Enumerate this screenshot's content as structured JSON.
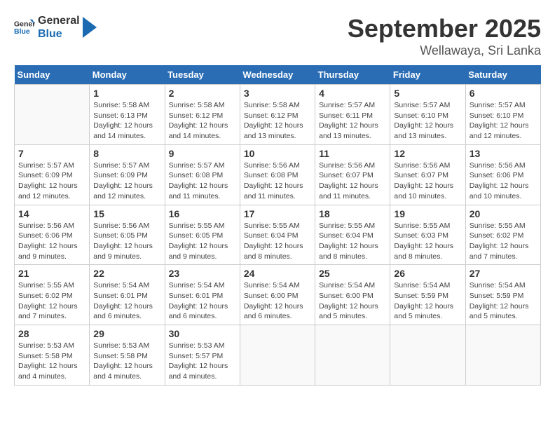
{
  "header": {
    "logo_general": "General",
    "logo_blue": "Blue",
    "title": "September 2025",
    "subtitle": "Wellawaya, Sri Lanka"
  },
  "calendar": {
    "days_of_week": [
      "Sunday",
      "Monday",
      "Tuesday",
      "Wednesday",
      "Thursday",
      "Friday",
      "Saturday"
    ],
    "weeks": [
      [
        {
          "day": "",
          "info": ""
        },
        {
          "day": "1",
          "info": "Sunrise: 5:58 AM\nSunset: 6:13 PM\nDaylight: 12 hours\nand 14 minutes."
        },
        {
          "day": "2",
          "info": "Sunrise: 5:58 AM\nSunset: 6:12 PM\nDaylight: 12 hours\nand 14 minutes."
        },
        {
          "day": "3",
          "info": "Sunrise: 5:58 AM\nSunset: 6:12 PM\nDaylight: 12 hours\nand 13 minutes."
        },
        {
          "day": "4",
          "info": "Sunrise: 5:57 AM\nSunset: 6:11 PM\nDaylight: 12 hours\nand 13 minutes."
        },
        {
          "day": "5",
          "info": "Sunrise: 5:57 AM\nSunset: 6:10 PM\nDaylight: 12 hours\nand 13 minutes."
        },
        {
          "day": "6",
          "info": "Sunrise: 5:57 AM\nSunset: 6:10 PM\nDaylight: 12 hours\nand 12 minutes."
        }
      ],
      [
        {
          "day": "7",
          "info": "Sunrise: 5:57 AM\nSunset: 6:09 PM\nDaylight: 12 hours\nand 12 minutes."
        },
        {
          "day": "8",
          "info": "Sunrise: 5:57 AM\nSunset: 6:09 PM\nDaylight: 12 hours\nand 12 minutes."
        },
        {
          "day": "9",
          "info": "Sunrise: 5:57 AM\nSunset: 6:08 PM\nDaylight: 12 hours\nand 11 minutes."
        },
        {
          "day": "10",
          "info": "Sunrise: 5:56 AM\nSunset: 6:08 PM\nDaylight: 12 hours\nand 11 minutes."
        },
        {
          "day": "11",
          "info": "Sunrise: 5:56 AM\nSunset: 6:07 PM\nDaylight: 12 hours\nand 11 minutes."
        },
        {
          "day": "12",
          "info": "Sunrise: 5:56 AM\nSunset: 6:07 PM\nDaylight: 12 hours\nand 10 minutes."
        },
        {
          "day": "13",
          "info": "Sunrise: 5:56 AM\nSunset: 6:06 PM\nDaylight: 12 hours\nand 10 minutes."
        }
      ],
      [
        {
          "day": "14",
          "info": "Sunrise: 5:56 AM\nSunset: 6:06 PM\nDaylight: 12 hours\nand 9 minutes."
        },
        {
          "day": "15",
          "info": "Sunrise: 5:56 AM\nSunset: 6:05 PM\nDaylight: 12 hours\nand 9 minutes."
        },
        {
          "day": "16",
          "info": "Sunrise: 5:55 AM\nSunset: 6:05 PM\nDaylight: 12 hours\nand 9 minutes."
        },
        {
          "day": "17",
          "info": "Sunrise: 5:55 AM\nSunset: 6:04 PM\nDaylight: 12 hours\nand 8 minutes."
        },
        {
          "day": "18",
          "info": "Sunrise: 5:55 AM\nSunset: 6:04 PM\nDaylight: 12 hours\nand 8 minutes."
        },
        {
          "day": "19",
          "info": "Sunrise: 5:55 AM\nSunset: 6:03 PM\nDaylight: 12 hours\nand 8 minutes."
        },
        {
          "day": "20",
          "info": "Sunrise: 5:55 AM\nSunset: 6:02 PM\nDaylight: 12 hours\nand 7 minutes."
        }
      ],
      [
        {
          "day": "21",
          "info": "Sunrise: 5:55 AM\nSunset: 6:02 PM\nDaylight: 12 hours\nand 7 minutes."
        },
        {
          "day": "22",
          "info": "Sunrise: 5:54 AM\nSunset: 6:01 PM\nDaylight: 12 hours\nand 6 minutes."
        },
        {
          "day": "23",
          "info": "Sunrise: 5:54 AM\nSunset: 6:01 PM\nDaylight: 12 hours\nand 6 minutes."
        },
        {
          "day": "24",
          "info": "Sunrise: 5:54 AM\nSunset: 6:00 PM\nDaylight: 12 hours\nand 6 minutes."
        },
        {
          "day": "25",
          "info": "Sunrise: 5:54 AM\nSunset: 6:00 PM\nDaylight: 12 hours\nand 5 minutes."
        },
        {
          "day": "26",
          "info": "Sunrise: 5:54 AM\nSunset: 5:59 PM\nDaylight: 12 hours\nand 5 minutes."
        },
        {
          "day": "27",
          "info": "Sunrise: 5:54 AM\nSunset: 5:59 PM\nDaylight: 12 hours\nand 5 minutes."
        }
      ],
      [
        {
          "day": "28",
          "info": "Sunrise: 5:53 AM\nSunset: 5:58 PM\nDaylight: 12 hours\nand 4 minutes."
        },
        {
          "day": "29",
          "info": "Sunrise: 5:53 AM\nSunset: 5:58 PM\nDaylight: 12 hours\nand 4 minutes."
        },
        {
          "day": "30",
          "info": "Sunrise: 5:53 AM\nSunset: 5:57 PM\nDaylight: 12 hours\nand 4 minutes."
        },
        {
          "day": "",
          "info": ""
        },
        {
          "day": "",
          "info": ""
        },
        {
          "day": "",
          "info": ""
        },
        {
          "day": "",
          "info": ""
        }
      ]
    ]
  }
}
